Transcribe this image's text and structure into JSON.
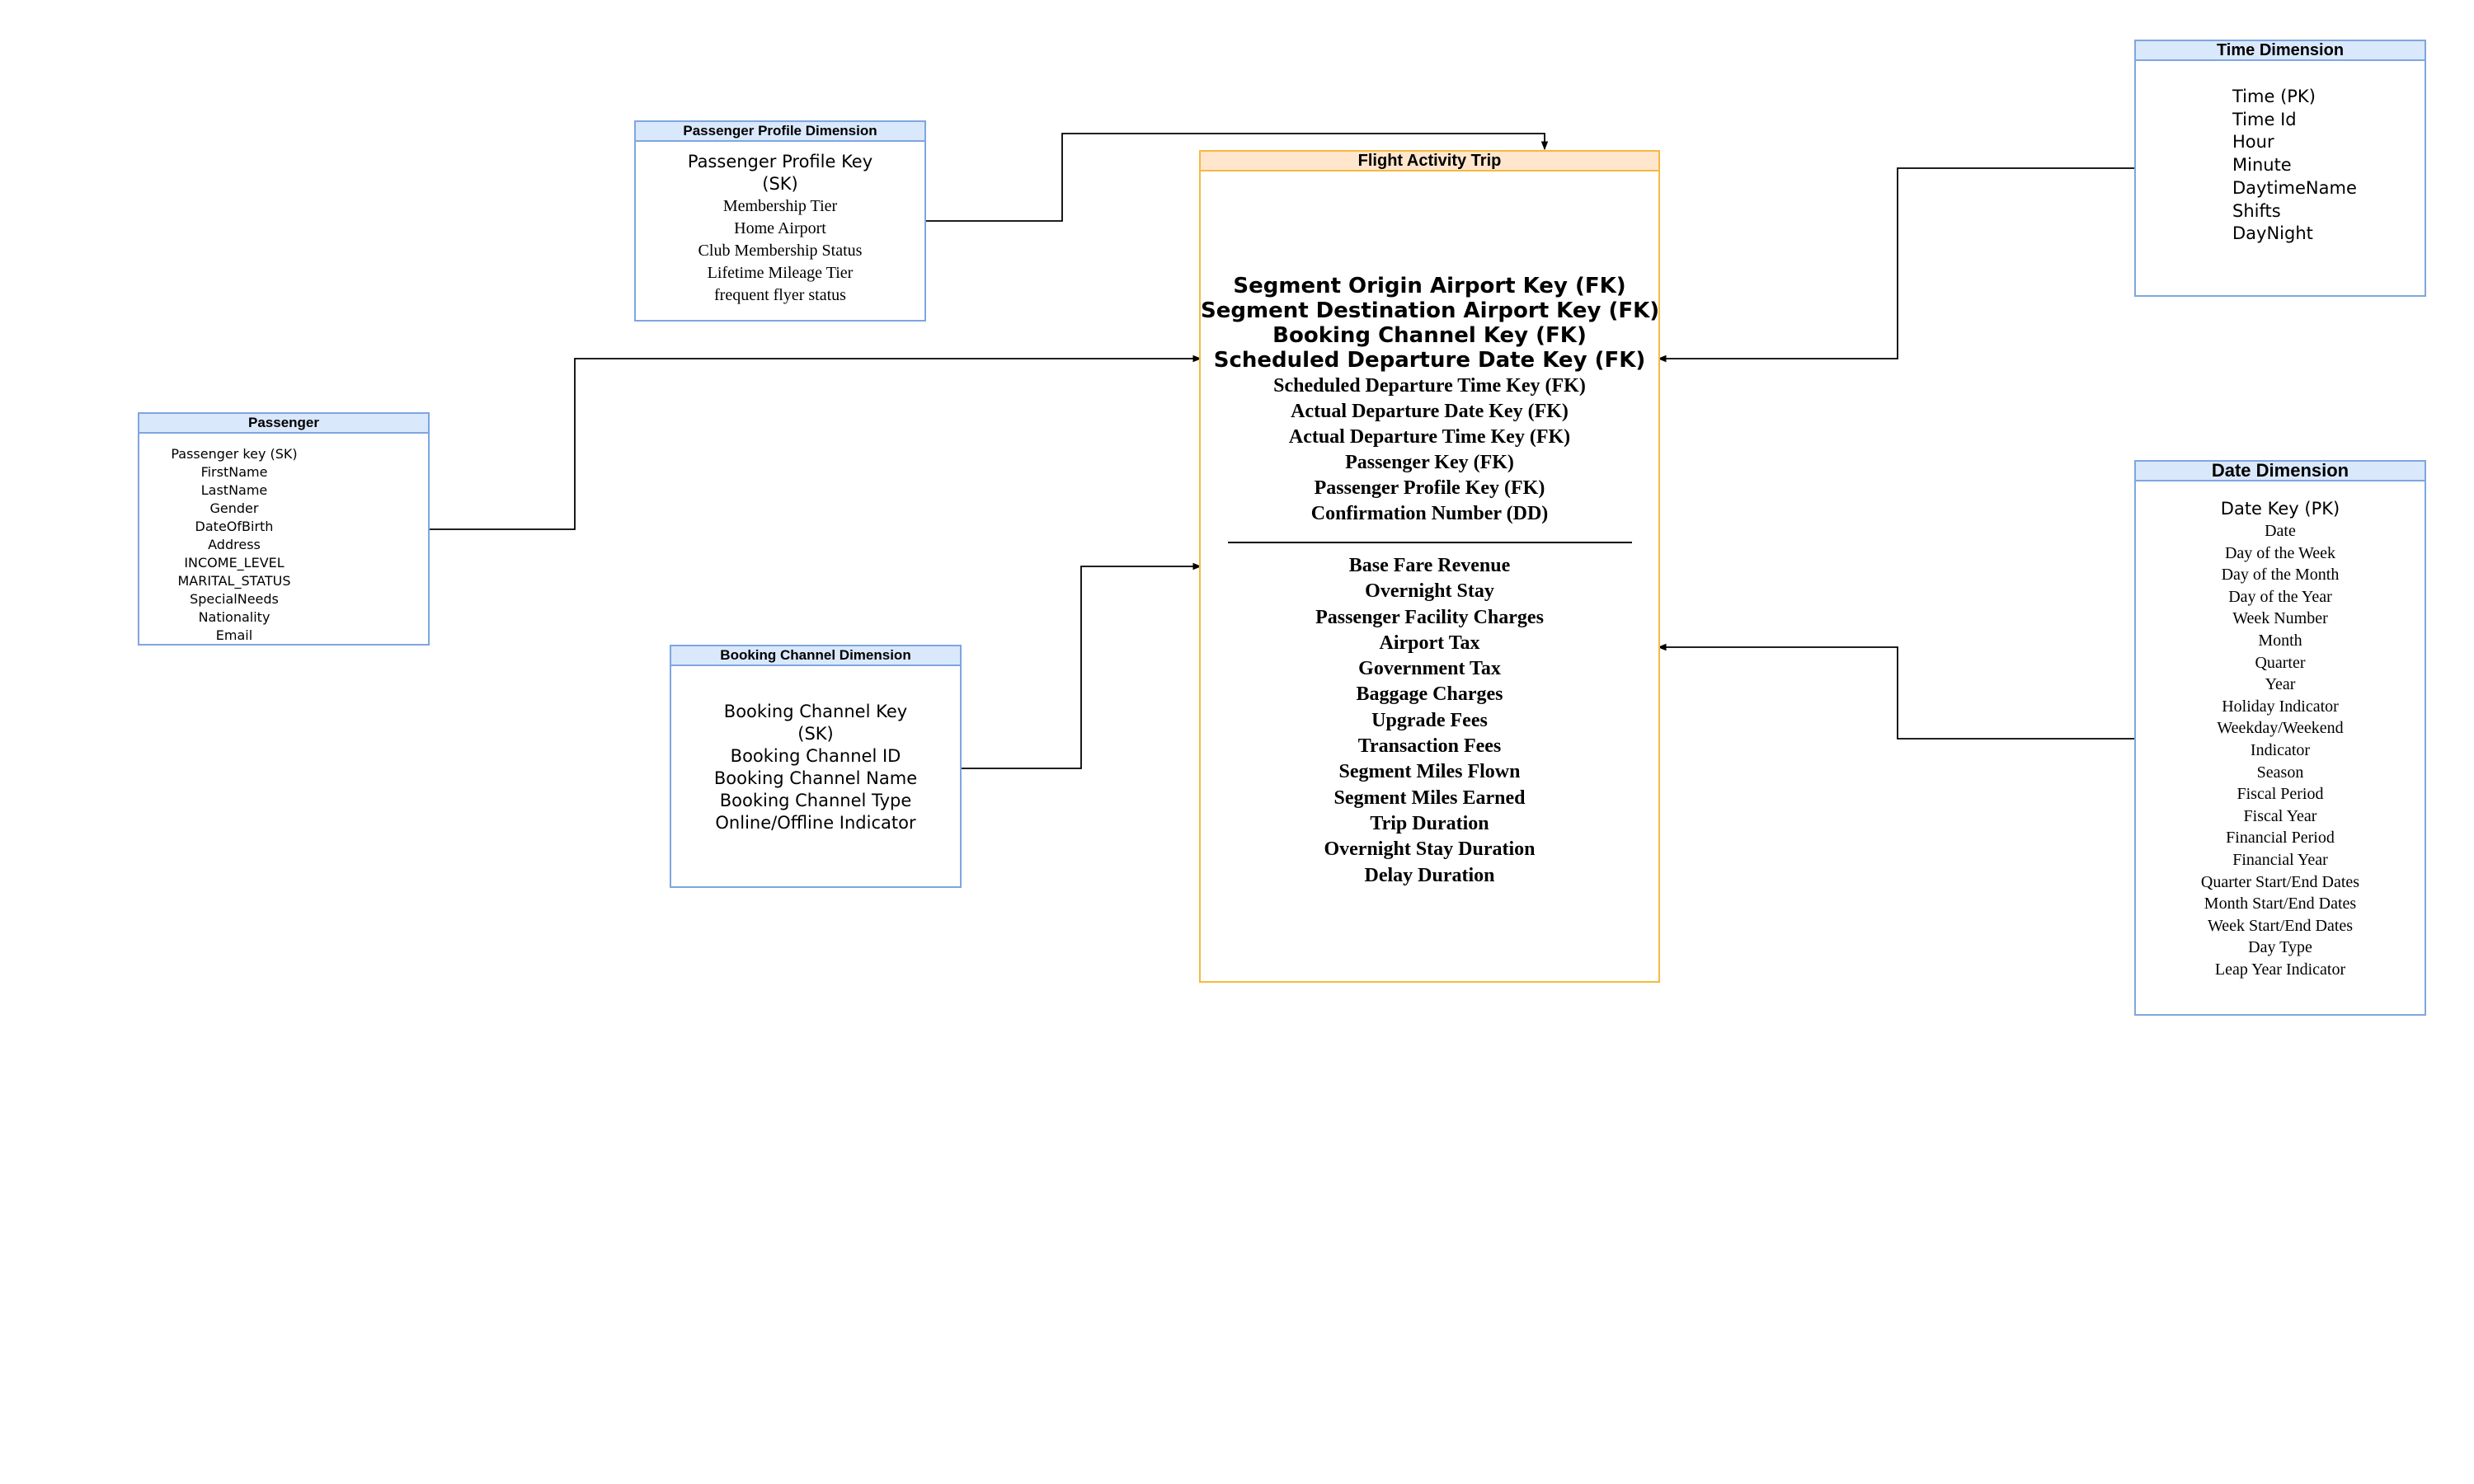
{
  "entities": {
    "passenger_profile": {
      "title": "Passenger Profile Dimension",
      "attrs": [
        "Passenger Profile Key",
        "(SK)",
        "Membership  Tier",
        "Home Airport",
        "Club Membership Status",
        "Lifetime Mileage Tier",
        "frequent flyer status"
      ]
    },
    "passenger": {
      "title": "Passenger",
      "attrs": [
        "Passenger key (SK)",
        "FirstName",
        "LastName",
        "Gender",
        "DateOfBirth",
        "Address",
        "INCOME_LEVEL",
        "MARITAL_STATUS",
        "SpecialNeeds",
        "Nationality",
        "Email"
      ]
    },
    "booking_channel": {
      "title": "Booking Channel Dimension",
      "attrs": [
        "Booking Channel Key",
        "(SK)",
        "Booking Channel ID",
        "Booking Channel Name",
        "Booking Channel Type",
        "Online/Offline Indicator"
      ]
    },
    "fact": {
      "title": "Flight Activity Trip",
      "keys_primary": [
        "Segment Origin Airport Key (FK)",
        "Segment Destination  Airport Key (FK)",
        "Booking Channel Key (FK)",
        "Scheduled Departure Date Key (FK)"
      ],
      "keys_secondary": [
        "Scheduled Departure Time Key (FK)",
        "Actual Departure Date Key (FK)",
        "Actual Departure Time Key (FK)",
        "Passenger Key (FK)",
        "Passenger Profile Key (FK)",
        "Confirmation Number (DD)"
      ],
      "measures": [
        "Base Fare Revenue",
        "Overnight Stay",
        "Passenger Facility Charges",
        "Airport Tax",
        "Government Tax",
        "Baggage Charges",
        "Upgrade Fees",
        "Transaction Fees",
        "Segment Miles Flown",
        "Segment Miles Earned",
        "Trip Duration",
        "Overnight Stay Duration",
        "Delay Duration"
      ]
    },
    "time": {
      "title": "Time Dimension",
      "attrs": [
        "Time (PK)",
        "Time Id",
        "Hour",
        "Minute",
        "DaytimeName",
        "Shifts",
        "DayNight"
      ]
    },
    "date": {
      "title": "Date Dimension",
      "attrs_sans": [
        "Date Key (PK)"
      ],
      "attrs": [
        "Date",
        "Day of the Week",
        "Day of the Month",
        "Day of the Year",
        "Week Number",
        "Month",
        "Quarter",
        "Year",
        "Holiday Indicator",
        "Weekday/Weekend",
        "Indicator",
        "Season",
        "Fiscal Period",
        "Fiscal Year",
        "Financial Period",
        "Financial Year",
        "Quarter Start/End Dates",
        "Month Start/End Dates",
        "Week Start/End Dates",
        "Day Type",
        "Leap Year Indicator"
      ]
    }
  },
  "colors": {
    "dimension_border": "#7ea6e0",
    "dimension_header": "#dae8fc",
    "fact_border": "#f5b942",
    "fact_header": "#ffe6cc",
    "connector": "#000000"
  }
}
